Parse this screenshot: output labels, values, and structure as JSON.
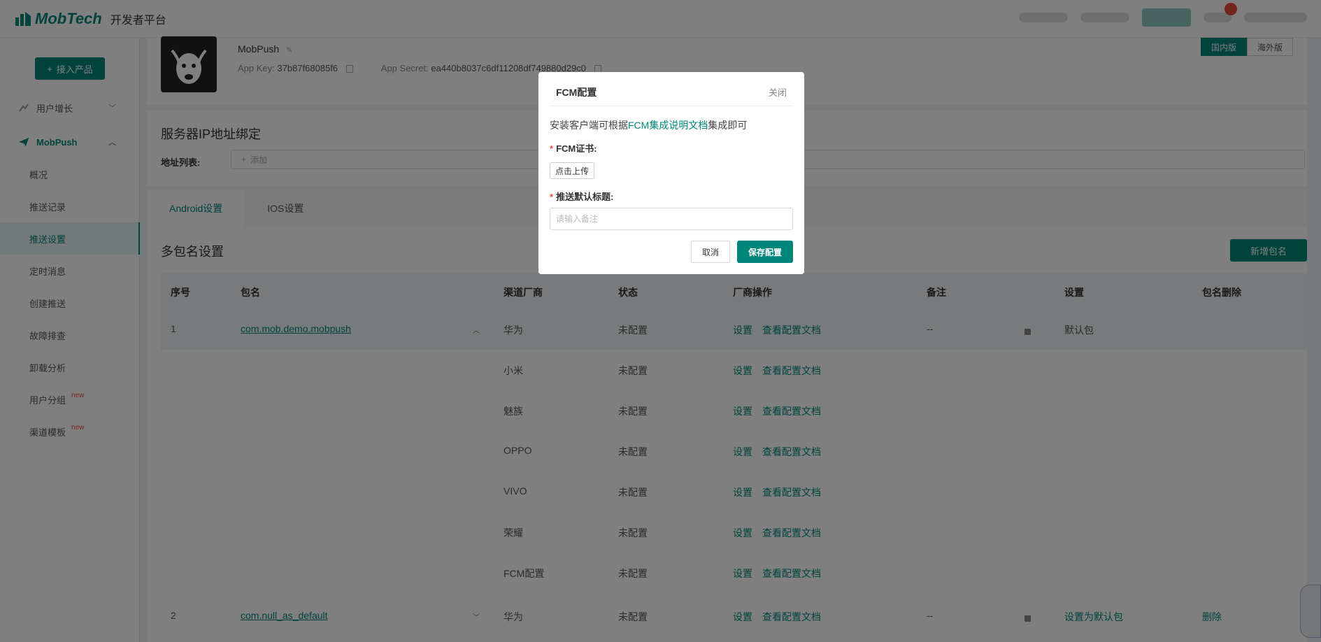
{
  "header": {
    "logo_text": "MobTech",
    "platform_name": "开发者平台"
  },
  "sidebar": {
    "join_button": "接入产品",
    "groups": [
      {
        "label": "用户增长"
      },
      {
        "label": "MobPush"
      }
    ],
    "items": [
      {
        "label": "概况"
      },
      {
        "label": "推送记录"
      },
      {
        "label": "推送设置"
      },
      {
        "label": "定时消息"
      },
      {
        "label": "创建推送"
      },
      {
        "label": "故障排查"
      },
      {
        "label": "卸载分析"
      },
      {
        "label": "用户分组",
        "tag": "new"
      },
      {
        "label": "渠道模板",
        "tag": "new"
      }
    ]
  },
  "app": {
    "name": "MobPush",
    "app_key_label": "App Key:",
    "app_key": "37b87f68085f6",
    "app_secret_label": "App Secret:",
    "app_secret": "ea440b8037c6df11208df749880d29c0",
    "region_tabs": [
      "国内版",
      "海外版"
    ]
  },
  "ip_binding": {
    "title": "服务器IP地址绑定",
    "label": "地址列表:",
    "add_text": "添加"
  },
  "tabs": [
    "Android设置",
    "IOS设置"
  ],
  "packages": {
    "title": "多包名设置",
    "add_button": "新增包名",
    "columns": [
      "序号",
      "包名",
      "渠道厂商",
      "状态",
      "厂商操作",
      "备注",
      "设置",
      "包名删除"
    ],
    "rows": [
      {
        "index": "1",
        "package": "com.mob.demo.mobpush",
        "vendor": "华为",
        "status": "未配置",
        "op1": "设置",
        "op2": "查看配置文档",
        "note": "--",
        "setting": "默认包",
        "delete": ""
      },
      {
        "index": "",
        "package": "",
        "vendor": "小米",
        "status": "未配置",
        "op1": "设置",
        "op2": "查看配置文档",
        "note": "",
        "setting": "",
        "delete": ""
      },
      {
        "index": "",
        "package": "",
        "vendor": "魅族",
        "status": "未配置",
        "op1": "设置",
        "op2": "查看配置文档",
        "note": "",
        "setting": "",
        "delete": ""
      },
      {
        "index": "",
        "package": "",
        "vendor": "OPPO",
        "status": "未配置",
        "op1": "设置",
        "op2": "查看配置文档",
        "note": "",
        "setting": "",
        "delete": ""
      },
      {
        "index": "",
        "package": "",
        "vendor": "VIVO",
        "status": "未配置",
        "op1": "设置",
        "op2": "查看配置文档",
        "note": "",
        "setting": "",
        "delete": ""
      },
      {
        "index": "",
        "package": "",
        "vendor": "荣耀",
        "status": "未配置",
        "op1": "设置",
        "op2": "查看配置文档",
        "note": "",
        "setting": "",
        "delete": ""
      },
      {
        "index": "",
        "package": "",
        "vendor": "FCM配置",
        "status": "未配置",
        "op1": "设置",
        "op2": "查看配置文档",
        "note": "",
        "setting": "",
        "delete": ""
      },
      {
        "index": "2",
        "package": "com.null_as_default",
        "vendor": "华为",
        "status": "未配置",
        "op1": "设置",
        "op2": "查看配置文档",
        "note": "--",
        "setting": "设置为默认包",
        "delete": "删除"
      }
    ]
  },
  "modal": {
    "title": "FCM配置",
    "close_label": "关闭",
    "desc_prefix": "安装客户端可根据",
    "desc_link": "FCM集成说明文档",
    "desc_suffix": "集成即可",
    "cert_label": "FCM证书:",
    "upload_button": "点击上传",
    "push_title_label": "推送默认标题:",
    "push_title_placeholder": "请输入备注",
    "cancel_button": "取消",
    "save_button": "保存配置"
  },
  "colors": {
    "brand": "#00877a",
    "danger": "#e74c3c"
  }
}
